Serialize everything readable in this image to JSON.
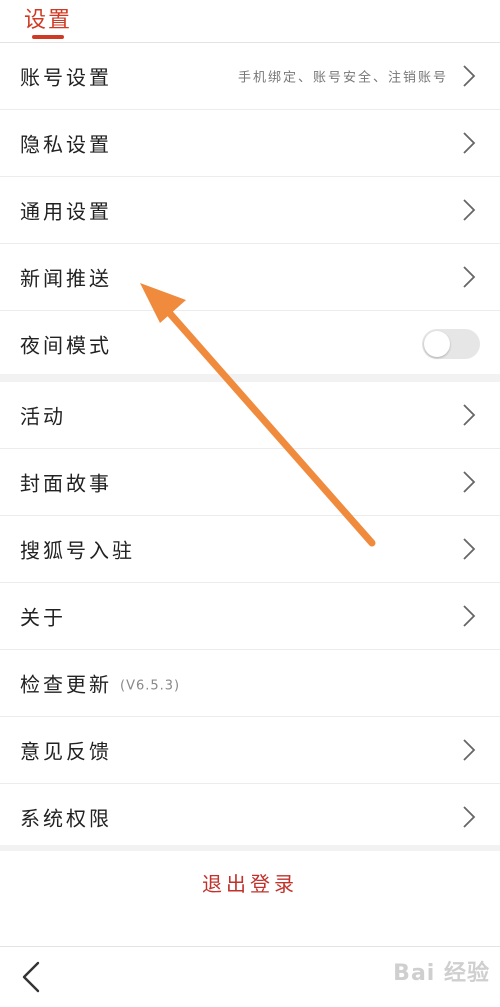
{
  "header": {
    "title": "设置"
  },
  "groups": [
    {
      "items": [
        {
          "label": "账号设置",
          "subtitle": "手机绑定、账号安全、注销账号"
        },
        {
          "label": "隐私设置"
        },
        {
          "label": "通用设置"
        },
        {
          "label": "新闻推送"
        },
        {
          "label": "夜间模式",
          "toggle": "off"
        }
      ]
    },
    {
      "items": [
        {
          "label": "活动"
        },
        {
          "label": "封面故事"
        },
        {
          "label": "搜狐号入驻"
        },
        {
          "label": "关于"
        },
        {
          "label": "检查更新",
          "version": "(V6.5.3)"
        },
        {
          "label": "意见反馈"
        },
        {
          "label": "系统权限"
        }
      ]
    }
  ],
  "logout": {
    "label": "退出登录"
  },
  "bottom_bar": {
    "back_icon": "chevron-left-icon",
    "watermark": "Bai 经验"
  },
  "colors": {
    "accent": "#d03a25",
    "logout": "#c0322b",
    "annotation_arrow": "#f08a3c",
    "separator": "#f2f2f2"
  }
}
